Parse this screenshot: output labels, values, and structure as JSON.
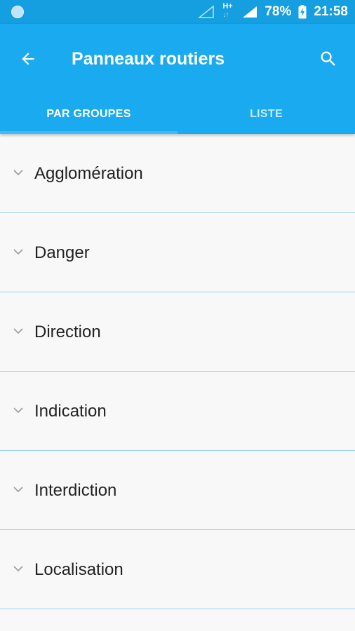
{
  "status_bar": {
    "battery": "78%",
    "time": "21:58",
    "network": "H+"
  },
  "appbar": {
    "title": "Panneaux routiers",
    "back_icon": "arrow-back-icon",
    "search_icon": "search-icon"
  },
  "tabs": [
    {
      "label": "PAR GROUPES",
      "selected": true
    },
    {
      "label": "LISTE",
      "selected": false
    }
  ],
  "groups": [
    {
      "label": "Agglomération"
    },
    {
      "label": "Danger"
    },
    {
      "label": "Direction"
    },
    {
      "label": "Indication"
    },
    {
      "label": "Interdiction"
    },
    {
      "label": "Localisation"
    }
  ],
  "colors": {
    "primary": "#1aaaf0",
    "status_bar": "#159ee0",
    "divider": "#9ad0f3"
  }
}
